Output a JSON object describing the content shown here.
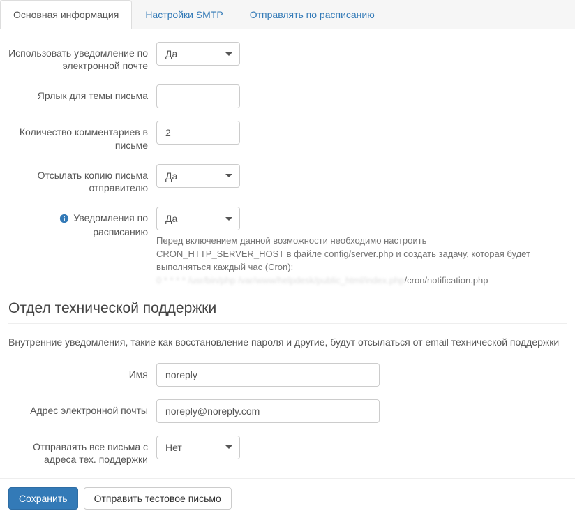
{
  "tabs": {
    "main": "Основная информация",
    "smtp": "Настройки SMTP",
    "schedule": "Отправлять по расписанию"
  },
  "fields": {
    "use_email_notification": {
      "label": "Использовать уведомление по электронной почте",
      "value": "Да"
    },
    "subject_label": {
      "label": "Ярлык для темы письма",
      "value": ""
    },
    "comments_per_email": {
      "label": "Количество комментариев в письме",
      "value": "2"
    },
    "send_copy_to_sender": {
      "label": "Отсылать копию письма отправителю",
      "value": "Да"
    },
    "scheduled_notifications": {
      "label": "Уведомления по расписанию",
      "value": "Да",
      "help_line1": "Перед включением данной возможности необходимо настроить CRON_HTTP_SERVER_HOST в файле config/server.php и создать задачу, которая будет выполняться каждый час (Cron):",
      "help_line2_suffix": "/cron/notification.php"
    }
  },
  "support_section": {
    "heading": "Отдел технической поддержки",
    "description": "Внутренние уведомления, такие как восстановление пароля и другие, будут отсылаться от email технической поддержки",
    "name": {
      "label": "Имя",
      "value": "noreply"
    },
    "email": {
      "label": "Адрес электронной почты",
      "value": "noreply@noreply.com"
    },
    "send_all_from_support": {
      "label": "Отправлять все письма с адреса тех. поддержки",
      "value": "Нет"
    }
  },
  "footer": {
    "save": "Сохранить",
    "test_email": "Отправить тестовое письмо"
  }
}
